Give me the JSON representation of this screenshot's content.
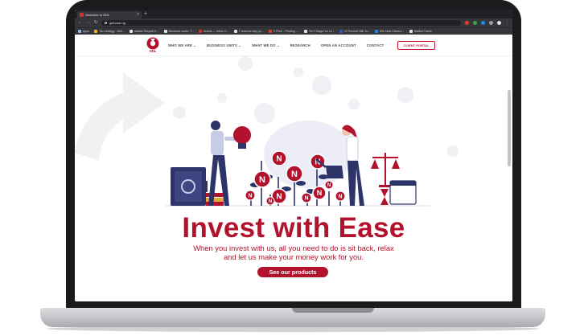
{
  "browser": {
    "tab_title": "Welcome to GDL",
    "url": "gdl.com.ng",
    "bookmarks": [
      "Apps",
      "Tax strategy - Wel...",
      "adidas Recycle E...",
      "Business cards: T...",
      "Assets — Inbox G...",
      "7 reasons why yo...",
      "X Print :: Printing -...",
      "Ten Things I've Le...",
      "12 Percent Will Ju...",
      "Win New Clients i...",
      "Mailba Farms"
    ]
  },
  "site": {
    "logo_text": "GDL",
    "nav": [
      "WHO WE ARE  ⌄",
      "BUSINESS UNITS  ⌄",
      "WHAT WE DO  ⌄",
      "RESEARCH",
      "OPEN AN ACCOUNT",
      "CONTACT"
    ],
    "portal_label": "CLIENT PORTAL"
  },
  "hero": {
    "headline": "Invest with Ease",
    "subline_1": "When you invest with us, all you need to do is sit back, relax",
    "subline_2": "and let us make your money work for you.",
    "cta_label": "See our products",
    "coin_symbol": "N"
  },
  "colors": {
    "brand_red": "#b3122d",
    "navy": "#2c3469",
    "lavender": "#c8cbe6"
  }
}
